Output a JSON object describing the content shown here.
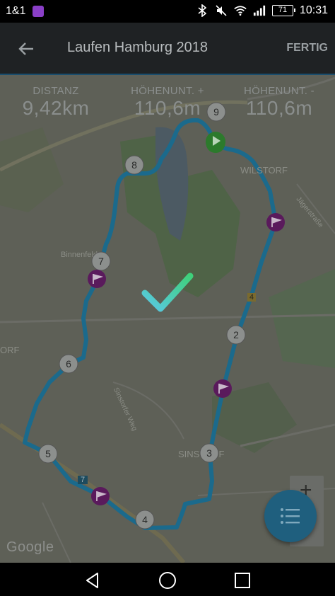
{
  "status_bar": {
    "carrier": "1&1",
    "battery": "71",
    "time": "10:31",
    "icons": [
      "bluetooth-icon",
      "mute-icon",
      "wifi-icon",
      "signal-icon"
    ]
  },
  "app_bar": {
    "title": "Laufen Hamburg 2018",
    "done_label": "FERTIG"
  },
  "stats": [
    {
      "label": "DISTANZ",
      "value": "9,42km"
    },
    {
      "label": "HÖHENUNT. +",
      "value": "110,6m"
    },
    {
      "label": "HÖHENUNT. -",
      "value": "110,6m"
    }
  ],
  "map": {
    "labels": {
      "wilstorf": "WILSTORF",
      "binnenfeld": "Binnenfeld",
      "sinstorf": "SINSTORF",
      "orf": "ORF",
      "sinstorfer_weg": "Sinstorfer Weg",
      "jaegerstrasse": "Jägerstraße",
      "road_4": "4",
      "road_7": "7"
    },
    "km_markers": [
      "2",
      "3",
      "4",
      "5",
      "6",
      "7",
      "8",
      "9"
    ],
    "google_logo": "Google"
  },
  "colors": {
    "route": "#1b6a8c",
    "flag": "#5a1a5c",
    "start": "#2c7a2c",
    "check_start": "#5ac8e6",
    "check_end": "#3fd07a"
  }
}
